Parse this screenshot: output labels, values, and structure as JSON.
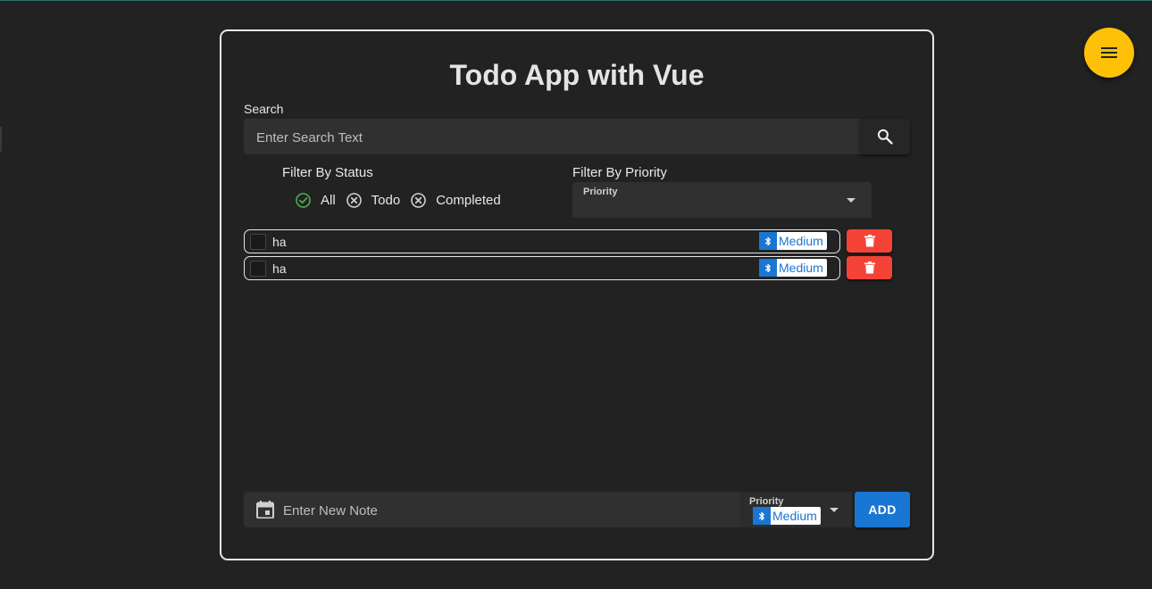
{
  "app": {
    "title": "Todo App with Vue"
  },
  "menu_button": {
    "icon": "hamburger-menu-icon",
    "color": "#ffc107"
  },
  "search": {
    "label": "Search",
    "placeholder": "Enter Search Text",
    "value": "",
    "button_icon": "search-icon"
  },
  "filter_status": {
    "label": "Filter By Status",
    "options": [
      {
        "label": "All",
        "icon": "check-circle-icon",
        "selected": true
      },
      {
        "label": "Todo",
        "icon": "close-circle-icon",
        "selected": false
      },
      {
        "label": "Completed",
        "icon": "close-circle-icon",
        "selected": false
      }
    ]
  },
  "filter_priority": {
    "label": "Filter By Priority",
    "select_label": "Priority",
    "value": ""
  },
  "todos": [
    {
      "text": "ha",
      "done": false,
      "priority": "Medium",
      "priority_icon": "bluetooth-icon"
    },
    {
      "text": "ha",
      "done": false,
      "priority": "Medium",
      "priority_icon": "bluetooth-icon"
    }
  ],
  "new_note": {
    "placeholder": "Enter New Note",
    "value": "",
    "icon": "calendar-icon",
    "priority_label": "Priority",
    "priority_value": "Medium",
    "priority_icon": "bluetooth-icon",
    "add_label": "ADD"
  },
  "colors": {
    "background": "#222222",
    "accent_blue": "#1976d2",
    "delete_red": "#f44336",
    "check_green": "#4caf50"
  }
}
